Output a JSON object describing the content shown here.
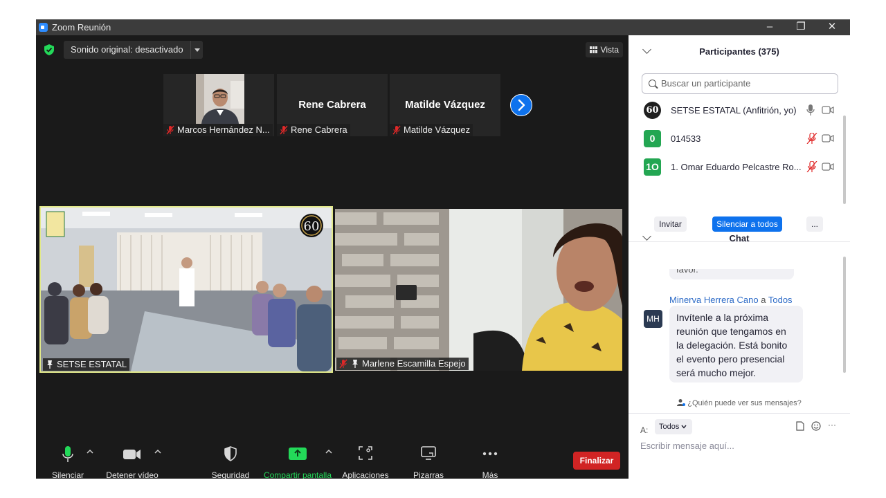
{
  "window": {
    "title": "Zoom Reunión",
    "minimize": "–",
    "restore": "❐",
    "close": "✕"
  },
  "meeting": {
    "audio_mode": "Sonido original: desactivado",
    "view_label": "Vista",
    "strip_tiles": [
      {
        "name": "Marcos Hernández N...",
        "has_video": true
      },
      {
        "name": "Rene Cabrera",
        "display_name": "Rene Cabrera"
      },
      {
        "name": "Matilde Vázquez",
        "display_name": "Matilde Vázquez"
      }
    ],
    "main_videos": [
      {
        "name": "SETSE ESTATAL",
        "badge": "60"
      },
      {
        "name": "Marlene Escamilla Espejo"
      }
    ]
  },
  "toolbar": {
    "mute": "Silenciar",
    "stop_video": "Detener vídeo",
    "security": "Seguridad",
    "share": "Compartir pantalla",
    "apps": "Aplicaciones",
    "whiteboards": "Pizarras",
    "more": "Más",
    "end": "Finalizar"
  },
  "participants": {
    "header": "Participantes (375)",
    "search_placeholder": "Buscar un participante",
    "list": [
      {
        "avatar": "60",
        "name": "SETSE ESTATAL (Anfitrión, yo)",
        "avatar_color": "#1f1f1f"
      },
      {
        "avatar": "0",
        "name": "014533",
        "avatar_color": "#23a652"
      },
      {
        "avatar": "1O",
        "name": "1. Omar Eduardo Pelcastre Ro...",
        "avatar_color": "#23a652"
      }
    ],
    "invite": "Invitar",
    "mute_all": "Silenciar a todos",
    "more": "..."
  },
  "chat": {
    "header": "Chat",
    "previous_tail": "favor.",
    "sender": "Minerva Herrera Cano",
    "sender_to_word": "a",
    "recipient": "Todos",
    "sender_initials": "MH",
    "message": "Invítenle a la próxima reunión que tengamos en la delegación. Está bonito el evento pero presencial será mucho mejor.",
    "who_can_see": "¿Quién puede ver sus mensajes?",
    "to_label": "A:",
    "to_value": "Todos",
    "input_placeholder": "Escribir mensaje aquí...",
    "more": "···"
  },
  "colors": {
    "accent": "#0e72ed",
    "share_green": "#23d959",
    "end_red": "#d12424",
    "mute_red": "#e02828",
    "active_speaker": "#e2e98a"
  }
}
